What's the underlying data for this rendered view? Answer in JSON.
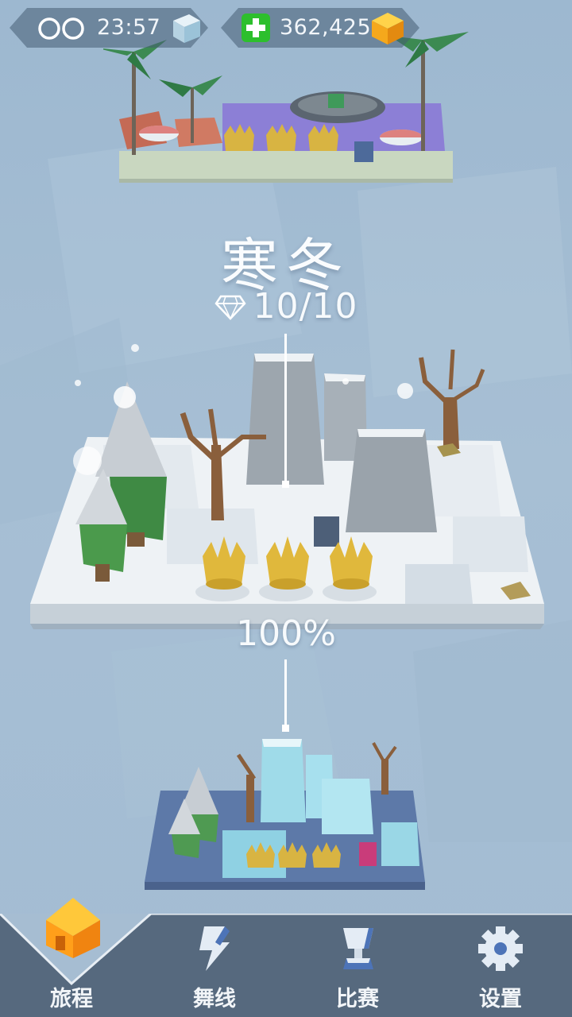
{
  "status": {
    "infinity_icon": "infinity-icon",
    "time": "23:57",
    "gems": "362,425"
  },
  "level": {
    "title": "寒冬",
    "gems_collected": "10/10",
    "progress": "100%",
    "progress_value": 1.0,
    "crowns_earned": 3
  },
  "nav": {
    "items": [
      {
        "label": "旅程",
        "icon": "house-icon",
        "active": true
      },
      {
        "label": "舞线",
        "icon": "line-icon",
        "active": false
      },
      {
        "label": "比赛",
        "icon": "trophy-icon",
        "active": false
      },
      {
        "label": "设置",
        "icon": "gear-icon",
        "active": false
      }
    ]
  },
  "colors": {
    "accent": "#ffb21e",
    "nav_bg": "#56697e",
    "plus_green": "#2dbf2d"
  }
}
